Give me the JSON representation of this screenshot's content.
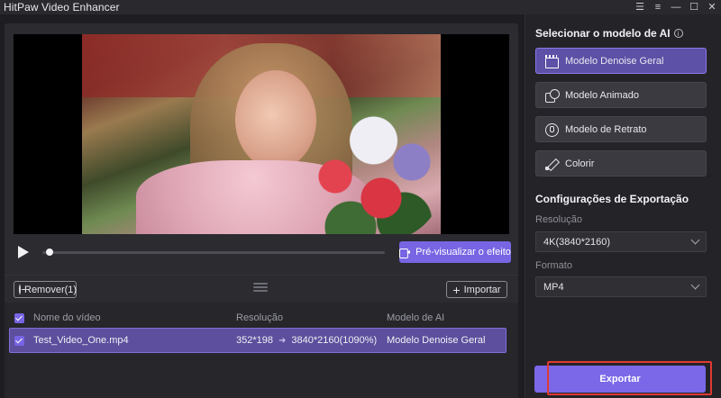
{
  "app": {
    "title": "HitPaw Video Enhancer"
  },
  "window_controls": [
    "menu-icon",
    "list-icon",
    "minimize",
    "maximize",
    "close"
  ],
  "player": {
    "preview_label": "Pré-visualizar o efeito",
    "progress": 0.02
  },
  "filelist": {
    "remove_label": "Remover(1)",
    "import_label": "Importar",
    "columns": [
      "Nome do vídeo",
      "Resolução",
      "Modelo de AI"
    ],
    "rows": [
      {
        "name": "Test_Video_One.mp4",
        "res_from": "352*198",
        "res_to": "3840*2160(1090%)",
        "model": "Modelo Denoise Geral",
        "checked": true
      }
    ]
  },
  "sidebar": {
    "ai_title": "Selecionar o modelo de AI",
    "models": [
      {
        "label": "Modelo Denoise Geral",
        "icon": "clapperboard-icon",
        "active": true
      },
      {
        "label": "Modelo Animado",
        "icon": "animation-icon",
        "active": false
      },
      {
        "label": "Modelo de Retrato",
        "icon": "face-icon",
        "active": false
      },
      {
        "label": "Colorir",
        "icon": "brush-icon",
        "active": false
      }
    ],
    "export_title": "Configurações de Exportação",
    "resolution_label": "Resolução",
    "resolution_value": "4K(3840*2160)",
    "format_label": "Formato",
    "format_value": "MP4",
    "export_label": "Exportar"
  },
  "colors": {
    "accent": "#7765e3",
    "highlight_box": "#e03a32"
  }
}
